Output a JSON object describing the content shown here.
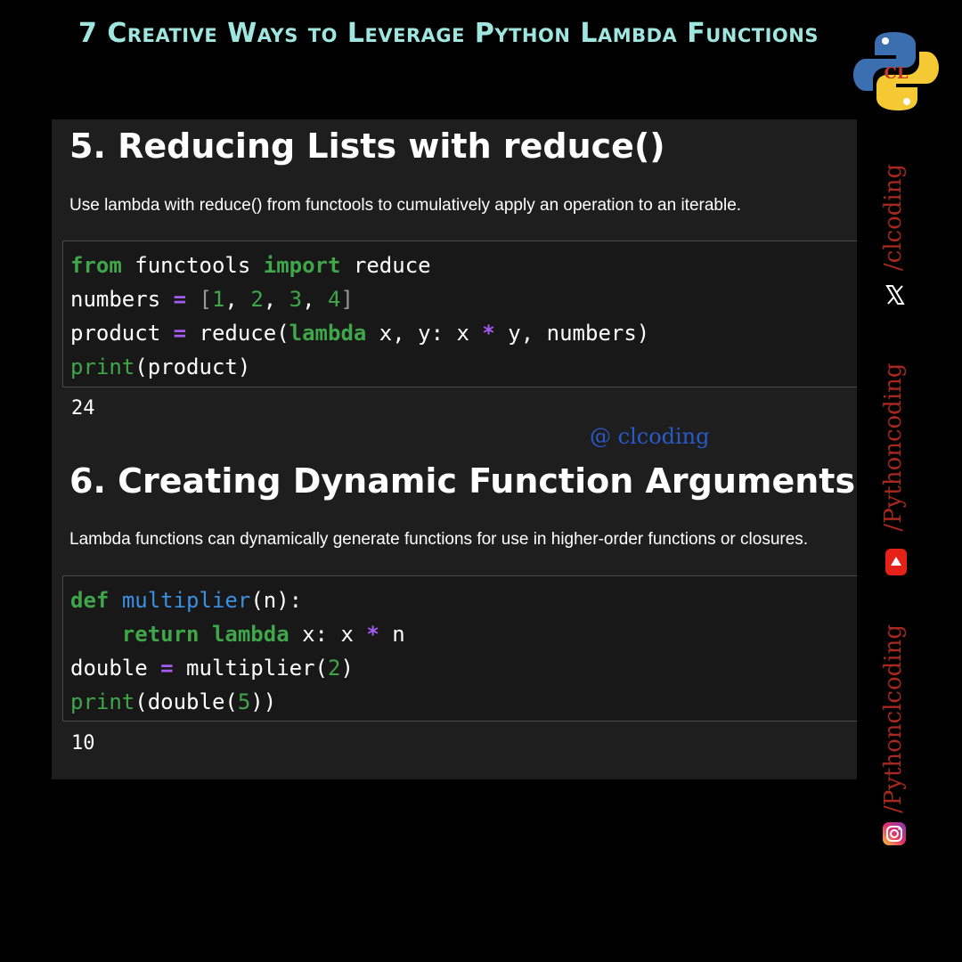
{
  "header": {
    "title": "7 Creative Ways to Leverage Python Lambda Functions",
    "logo_icon": "python-logo-icon",
    "logo_text": "CL"
  },
  "section5": {
    "heading": "5. Reducing Lists with reduce()",
    "description": "Use lambda with reduce() from functools to cumulatively apply an operation to an iterable.",
    "output": "24"
  },
  "watermark": "@ clcoding",
  "section6": {
    "heading": "6. Creating Dynamic Function Arguments",
    "description": "Lambda functions can dynamically generate functions for use in higher-order functions or closures.",
    "output": "10"
  },
  "social": {
    "x_handle": "/clcoding",
    "x_icon": "x-logo-icon",
    "youtube_handle": "/Pythoncoding",
    "youtube_icon": "youtube-icon",
    "instagram_handle": "/Pythonclcoding",
    "instagram_icon": "instagram-icon"
  },
  "colors": {
    "title": "#9fe6e0",
    "keyword": "#3fa64a",
    "operator": "#a45cf0",
    "function_name": "#3a8fe0",
    "watermark": "#2a59c8",
    "social_text": "#a8281f",
    "panel_bg": "#1e1e1e"
  }
}
